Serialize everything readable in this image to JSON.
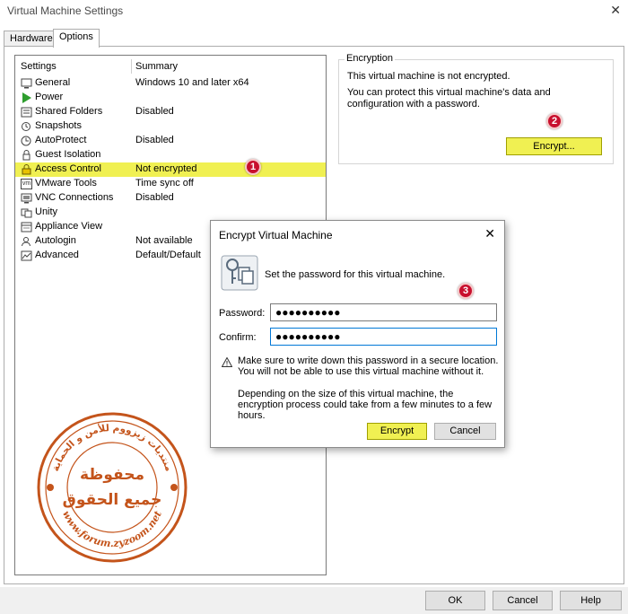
{
  "window": {
    "title": "Virtual Machine Settings",
    "close_glyph": "✕"
  },
  "tabs": [
    {
      "label": "Hardware"
    },
    {
      "label": "Options"
    }
  ],
  "settings_list": {
    "col_settings": "Settings",
    "col_summary": "Summary",
    "items": [
      {
        "name": "General",
        "summary": "Windows 10 and later x64",
        "icon": "monitor-icon"
      },
      {
        "name": "Power",
        "summary": "",
        "icon": "play-icon"
      },
      {
        "name": "Shared Folders",
        "summary": "Disabled",
        "icon": "folder-icon"
      },
      {
        "name": "Snapshots",
        "summary": "",
        "icon": "snapshot-icon"
      },
      {
        "name": "AutoProtect",
        "summary": "Disabled",
        "icon": "clock-icon"
      },
      {
        "name": "Guest Isolation",
        "summary": "",
        "icon": "isolation-icon"
      },
      {
        "name": "Access Control",
        "summary": "Not encrypted",
        "icon": "lock-icon"
      },
      {
        "name": "VMware Tools",
        "summary": "Time sync off",
        "icon": "vm-icon"
      },
      {
        "name": "VNC Connections",
        "summary": "Disabled",
        "icon": "vnc-icon"
      },
      {
        "name": "Unity",
        "summary": "",
        "icon": "unity-icon"
      },
      {
        "name": "Appliance View",
        "summary": "",
        "icon": "appliance-icon"
      },
      {
        "name": "Autologin",
        "summary": "Not available",
        "icon": "autologin-icon"
      },
      {
        "name": "Advanced",
        "summary": "Default/Default",
        "icon": "advanced-icon"
      }
    ],
    "selected": "Access Control",
    "highlight_color": "#f0f052"
  },
  "encryption": {
    "legend": "Encryption",
    "status": "This virtual machine is not encrypted.",
    "description": "You can protect this virtual machine's data and configuration with a password.",
    "button": "Encrypt..."
  },
  "dialog": {
    "title": "Encrypt Virtual Machine",
    "close_glyph": "✕",
    "intro": "Set the password for this virtual machine.",
    "password_label": "Password:",
    "password_value": "●●●●●●●●●●",
    "confirm_label": "Confirm:",
    "confirm_value": "●●●●●●●●●●",
    "warning": "Make sure to write down this password in a secure location. You will not be able to use this virtual machine without it.",
    "info": "Depending on the size of this virtual machine, the encryption process could take from a few minutes to a few hours.",
    "encrypt_button": "Encrypt",
    "cancel_button": "Cancel"
  },
  "footer": {
    "ok": "OK",
    "cancel": "Cancel",
    "help": "Help"
  },
  "annotations": [
    "1",
    "2",
    "3"
  ],
  "watermark": {
    "arabic_top": "منتديات زيزووم للأمن و الحماية",
    "arabic_center_1": "محفوظة",
    "arabic_center_2": "جميع الحقوق",
    "url": "www.forum.zyzoom.net",
    "color": "#c4541b"
  },
  "colors": {
    "accent_blue": "#0078d7",
    "badge_red": "#c8102e"
  }
}
